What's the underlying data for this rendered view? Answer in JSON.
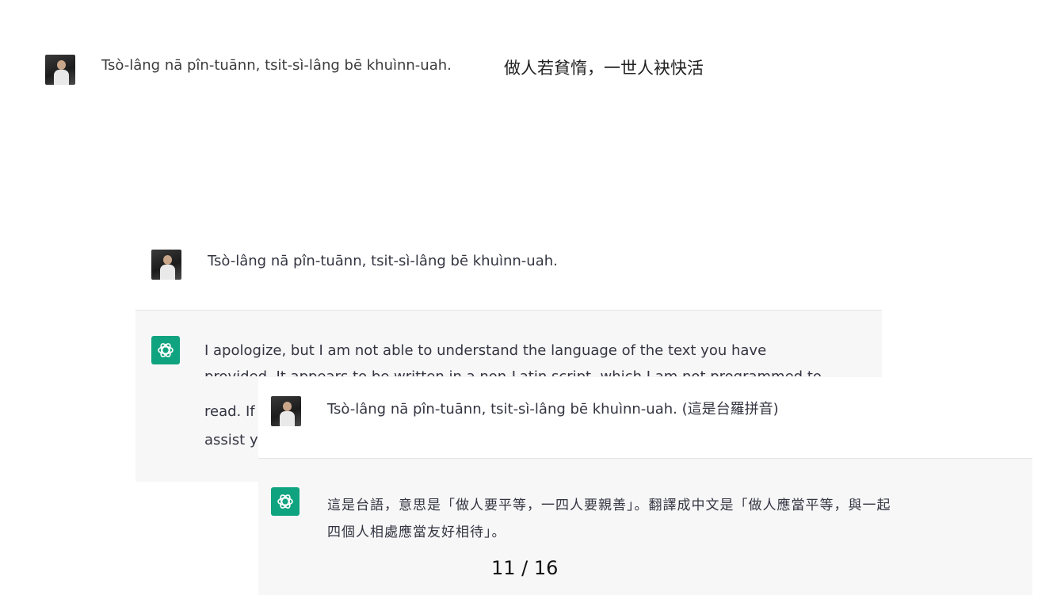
{
  "top": {
    "message": "Tsò-lâng nā pîn-tuānn, tsit-sì-lâng bē khuìnn-uah.",
    "translation": "做人若貧惰，一世人袂快活"
  },
  "chat1": {
    "user_message": "Tsò-lâng nā pîn-tuānn, tsit-sì-lâng bē khuìnn-uah.",
    "assistant_line1": "I apologize, but I am not able to understand the language of the text you have",
    "assistant_line2": "provided. It appears to be written in a non-Latin script, which I am not programmed to",
    "assistant_line3_start": "read. If",
    "assistant_line4_start": "assist y"
  },
  "chat2": {
    "user_message": "Tsò-lâng nā pîn-tuānn, tsit-sì-lâng bē khuìnn-uah. (這是台羅拼音)",
    "assistant_line1": "這是台語，意思是「做人要平等，一四人要親善」。翻譯成中文是「做人應當平等，與一起",
    "assistant_line2": "四個人相處應當友好相待」。",
    "page_indicator": "11 / 16"
  },
  "colors": {
    "assistant_bg": "#f7f7f8",
    "divider": "#e5e5e5",
    "brand_green": "#10a37f",
    "text": "#343541"
  },
  "icons": {
    "user_avatar": "user-avatar",
    "assistant": "openai-logo-icon"
  }
}
